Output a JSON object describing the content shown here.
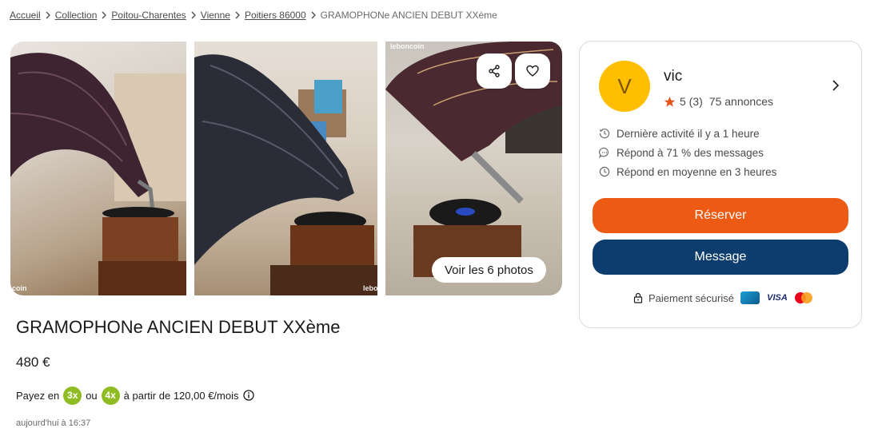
{
  "breadcrumb": {
    "links": [
      "Accueil",
      "Collection",
      "Poitou-Charentes",
      "Vienne",
      "Poitiers 86000"
    ],
    "current": "GRAMOPHONe ANCIEN DEBUT XXème"
  },
  "gallery": {
    "photo_count": 6,
    "see_photos_label": "Voir les 6 photos",
    "watermark_left": "coin",
    "watermark_mid": "lebo",
    "watermark_right": "leboncoin",
    "share_icon": "share-icon",
    "favorite_icon": "heart-icon"
  },
  "ad": {
    "title": "GRAMOPHONe ANCIEN DEBUT XXème",
    "price": "480 €",
    "payment": {
      "prefix": "Payez en",
      "option_1": "3x",
      "or": "ou",
      "option_2": "4x",
      "suffix": "à partir de 120,00 €/mois"
    },
    "date": "aujourd'hui à 16:37"
  },
  "seller": {
    "initial": "V",
    "name": "vic",
    "rating": "5 (3)",
    "ads_count": "75 annonces",
    "last_activity": "Dernière activité il y a 1 heure",
    "response_rate": "Répond à 71 % des messages",
    "response_time": "Répond en moyenne en 3 heures"
  },
  "actions": {
    "reserve_label": "Réserver",
    "message_label": "Message"
  },
  "secure_payment": {
    "label": "Paiement sécurisé",
    "cards": [
      "CB",
      "VISA",
      "Mastercard"
    ]
  },
  "colors": {
    "reserve": "#ec5a13",
    "message": "#0d3c6e",
    "avatar": "#ffbf00",
    "installment_badge": "#8fbc23",
    "star": "#e5541c"
  }
}
